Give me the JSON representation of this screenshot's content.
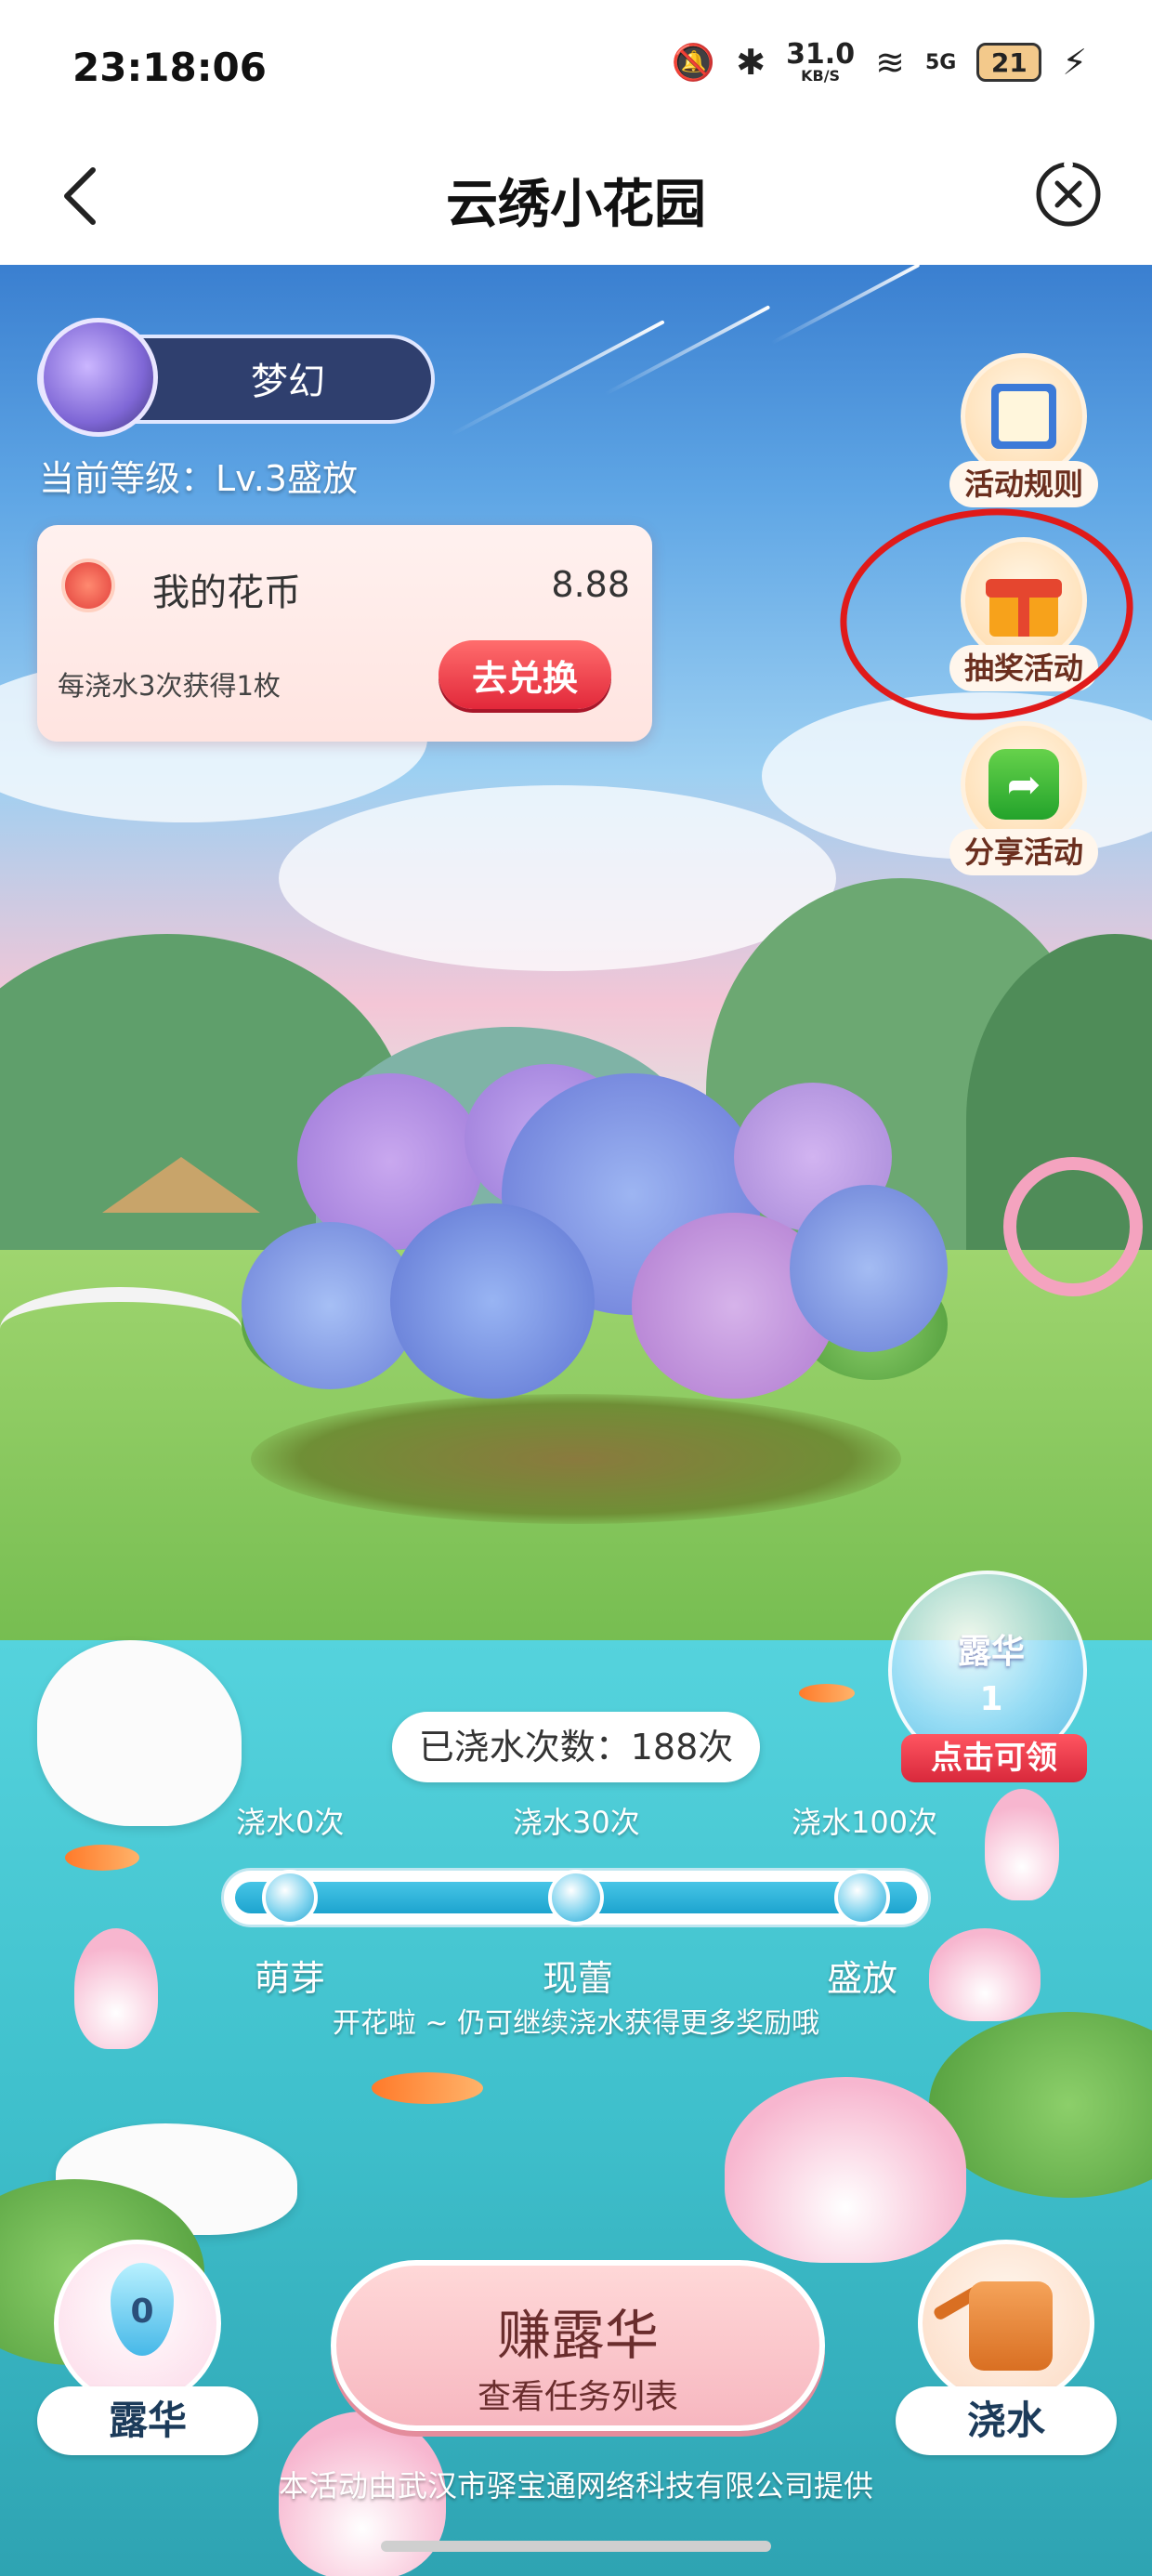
{
  "status_bar": {
    "time": "23:18:06",
    "net_speed": "31.0",
    "net_unit": "KB/S",
    "network": "5G",
    "battery": "21"
  },
  "nav": {
    "title": "云绣小花园"
  },
  "level": {
    "name": "梦幻",
    "text": "当前等级：Lv.3盛放"
  },
  "coin_card": {
    "label": "我的花币",
    "value": "8.88",
    "hint": "每浇水3次获得1枚",
    "exchange_label": "去兑换"
  },
  "side_buttons": {
    "rules": "活动规则",
    "lottery": "抽奖活动",
    "share": "分享活动"
  },
  "dew_bubble": {
    "label": "露华",
    "count": "1",
    "claim": "点击可领"
  },
  "watering": {
    "count_text": "已浇水次数：188次",
    "progress": 1.0,
    "milestones": [
      {
        "top": "浇水0次",
        "bottom": "萌芽"
      },
      {
        "top": "浇水30次",
        "bottom": "现蕾"
      },
      {
        "top": "浇水100次",
        "bottom": "盛放"
      }
    ],
    "hint": "开花啦 ~ 仍可继续浇水获得更多奖励哦"
  },
  "bottom": {
    "dew_count": "0",
    "dew_label": "露华",
    "earn_title": "赚露华",
    "earn_sub": "查看任务列表",
    "water_label": "浇水"
  },
  "footer": "本活动由武汉市驿宝通网络科技有限公司提供",
  "colors": {
    "annotation_circle": "#e01a1a",
    "exchange_button": "#e2283a",
    "level_pill": "#2f3f6e"
  }
}
